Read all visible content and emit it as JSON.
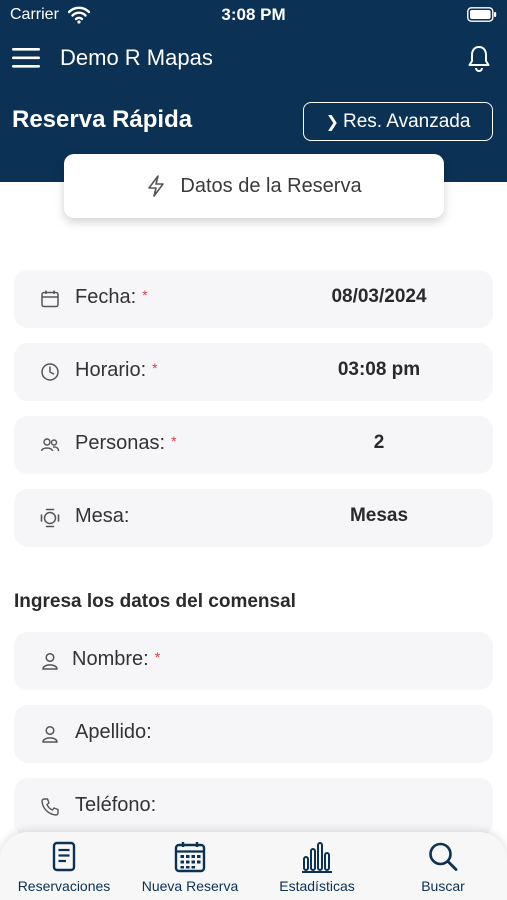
{
  "status_bar": {
    "carrier": "Carrier",
    "time": "3:08 PM"
  },
  "header": {
    "app_title": "Demo R Mapas",
    "page_title": "Reserva Rápida",
    "advanced_button": "Res. Avanzada"
  },
  "tab": {
    "label": "Datos de la Reserva"
  },
  "reservation_fields": [
    {
      "label": "Fecha:",
      "required": "*",
      "value": "08/03/2024",
      "icon": "calendar-icon"
    },
    {
      "label": "Horario:",
      "required": "*",
      "value": "03:08 pm",
      "icon": "clock-icon"
    },
    {
      "label": "Personas:",
      "required": "*",
      "value": "2",
      "icon": "people-icon"
    },
    {
      "label": "Mesa:",
      "value": "Mesas",
      "icon": "table-icon"
    }
  ],
  "guest_section": {
    "heading": "Ingresa los datos del comensal",
    "fields": [
      {
        "label": "Nombre:",
        "required": "*",
        "icon": "person-icon"
      },
      {
        "label": "Apellido:",
        "icon": "person-icon"
      },
      {
        "label": "Teléfono:",
        "icon": "phone-icon"
      }
    ]
  },
  "bottom_nav": [
    {
      "label": "Reservaciones",
      "icon": "document-icon"
    },
    {
      "label": "Nueva Reserva",
      "icon": "calendar-grid-icon"
    },
    {
      "label": "Estadísticas",
      "icon": "bar-chart-icon"
    },
    {
      "label": "Buscar",
      "icon": "search-icon"
    }
  ],
  "colors": {
    "primary": "#0b3155",
    "required": "#e0394a",
    "field_bg": "#f6f6f8"
  }
}
